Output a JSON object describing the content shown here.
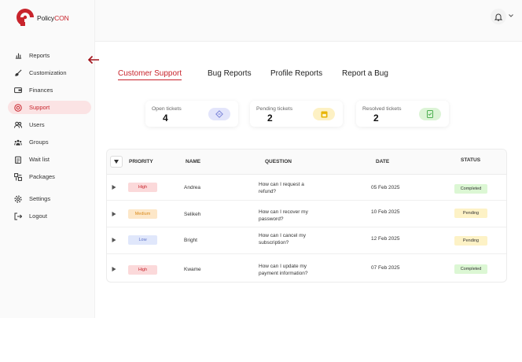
{
  "brand": {
    "name_prefix": "Policy",
    "name_suffix": "CON",
    "accent": "#c8242c"
  },
  "sidebar": {
    "items": [
      {
        "label": "Reports",
        "icon": "bar-chart-icon"
      },
      {
        "label": "Customization",
        "icon": "brush-icon"
      },
      {
        "label": "Finances",
        "icon": "wallet-icon"
      },
      {
        "label": "Support",
        "icon": "support-icon",
        "active": true
      },
      {
        "label": "Users",
        "icon": "users-icon"
      },
      {
        "label": "Groups",
        "icon": "groups-icon"
      },
      {
        "label": "Wait list",
        "icon": "clipboard-icon"
      },
      {
        "label": "Packages",
        "icon": "packages-icon"
      },
      {
        "label": "Settings",
        "icon": "gear-icon"
      },
      {
        "label": "Logout",
        "icon": "logout-icon"
      }
    ]
  },
  "tabs": [
    {
      "label": "Customer Support",
      "active": true
    },
    {
      "label": "Bug Reports"
    },
    {
      "label": "Profile Reports"
    },
    {
      "label": "Report a Bug"
    }
  ],
  "stats": [
    {
      "label": "Open tickets",
      "value": "4",
      "icon": "ticket-icon",
      "color": "#e3e5fb"
    },
    {
      "label": "Pending tickets",
      "value": "2",
      "icon": "note-icon",
      "color": "#fdf1c4"
    },
    {
      "label": "Resolved tickets",
      "value": "2",
      "icon": "check-doc-icon",
      "color": "#dcf4d6"
    }
  ],
  "table": {
    "headers": {
      "priority": "PRIORITY",
      "name": "NAME",
      "question": "QUESTION",
      "date": "DATE",
      "status": "STATUS"
    },
    "rows": [
      {
        "priority": "High",
        "name": "Andrea",
        "question": [
          "How can I request a",
          "refund?"
        ],
        "date": "05 Feb 2025",
        "status": "Completed"
      },
      {
        "priority": "Medium",
        "name": "Selikeh",
        "question": [
          "How can I recover my",
          "password?"
        ],
        "date": "10 Feb 2025",
        "status": "Pending"
      },
      {
        "priority": "Low",
        "name": "Bright",
        "question": [
          "How can I cancel my",
          "subscription?"
        ],
        "date": "12 Feb 2025",
        "status": "Pending"
      },
      {
        "priority": "High",
        "name": "Kwame",
        "question": [
          "How can I update my",
          "payment information?"
        ],
        "date": "07 Feb 2025",
        "status": "Completed"
      }
    ]
  },
  "colors": {
    "priority": {
      "High": "#fbd9da",
      "Medium": "#fde7c8",
      "Low": "#e0e7fb"
    },
    "priority_text": {
      "High": "#c8242c",
      "Medium": "#d98a1a",
      "Low": "#5a6fc8"
    },
    "status": {
      "Completed": "#dcf7d4",
      "Pending": "#fdf2c6"
    }
  }
}
